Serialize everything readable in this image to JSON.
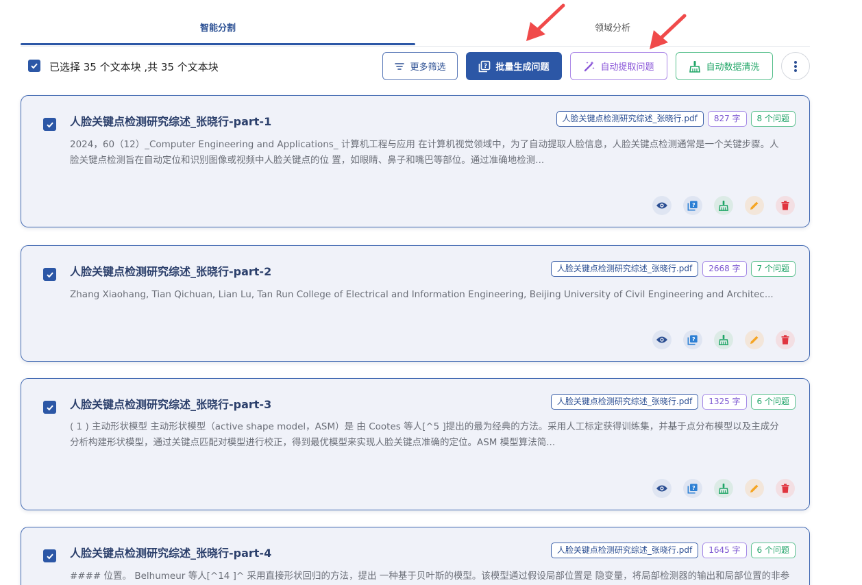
{
  "tabs": [
    {
      "label": "智能分割",
      "active": true
    },
    {
      "label": "领域分析",
      "active": false
    }
  ],
  "toolbar": {
    "selection_text": "已选择 35 个文本块 ,共 35 个文本块",
    "selected_all": true,
    "filter_label": "更多筛选",
    "batch_label": "批量生成问题",
    "extract_label": "自动提取问题",
    "clean_label": "自动数据清洗"
  },
  "colors": {
    "primary": "#2c57a6",
    "purple": "#8a56d8",
    "green": "#1fa566",
    "orange": "#f5a524",
    "red": "#e0343f",
    "annotation_arrow": "#f04a4a"
  },
  "icons": {
    "filter": "filter-lines-icon",
    "batch": "quiz-icon",
    "extract": "magic-wand-icon",
    "clean": "broom-icon",
    "more": "vertical-dots-icon",
    "view": "eye-icon",
    "generate": "quiz-icon",
    "clean_item": "broom-icon",
    "edit": "pencil-icon",
    "delete": "trash-icon"
  },
  "chunks": [
    {
      "title": "人脸关键点检测研究综述_张晓行-part-1",
      "file": "人脸关键点检测研究综述_张晓行.pdf",
      "chars": "827 字",
      "questions": "8 个问题",
      "checked": true,
      "text_lines": [
        "2024，60（12）_Computer Engineering and Applications_ 计算机工程与应用 在计算机视觉领域中，为了自动提取人脸信息，人脸关键点检测通常是一个关键步骤。人",
        "脸关键点检测旨在自动定位和识别图像或视频中人脸关键点的位 置，如眼睛、鼻子和嘴巴等部位。通过准确地检测..."
      ]
    },
    {
      "title": "人脸关键点检测研究综述_张晓行-part-2",
      "file": "人脸关键点检测研究综述_张晓行.pdf",
      "chars": "2668 字",
      "questions": "7 个问题",
      "checked": true,
      "text_lines": [
        "Zhang Xiaohang, Tian Qichuan, Lian Lu, Tan Run College of Electrical and Information Engineering, Beijing University of Civil Engineering and Architec..."
      ]
    },
    {
      "title": "人脸关键点检测研究综述_张晓行-part-3",
      "file": "人脸关键点检测研究综述_张晓行.pdf",
      "chars": "1325 字",
      "questions": "6 个问题",
      "checked": true,
      "text_lines": [
        "( 1 ) 主动形状模型 主动形状模型（active shape model，ASM）是 由 Cootes 等人[^5 ]提出的最为经典的方法。采用人工标定获得训练集，并基于点分布模型以及主成分",
        "分析构建形状模型，通过关键点匹配对模型进行校正，得到最优模型来实现人脸关键点准确的定位。ASM 模型算法简..."
      ]
    },
    {
      "title": "人脸关键点检测研究综述_张晓行-part-4",
      "file": "人脸关键点检测研究综述_张晓行.pdf",
      "chars": "1645 字",
      "questions": "6 个问题",
      "checked": true,
      "text_lines": [
        "#### 位置。 Belhumeur 等人[^14 ]^ 采用直接形状回归的方法，提出 一种基于贝叶斯的模型。该模型通过假设局部位置是 隐变量，将局部检测器的输出和局部位置的非参"
      ]
    }
  ]
}
